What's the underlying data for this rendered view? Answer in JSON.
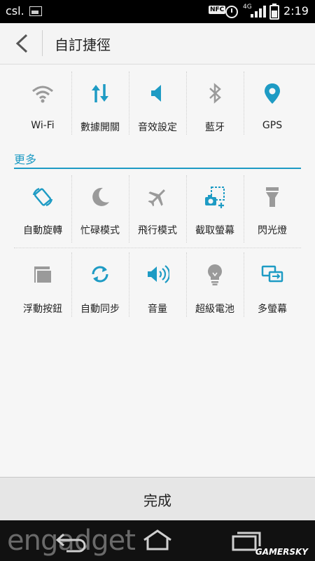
{
  "status_bar": {
    "carrier": "csl.",
    "network": "4G",
    "time": "2:19",
    "nfc": "NFC"
  },
  "header": {
    "back_icon": "chevron-left-icon",
    "title": "自訂捷徑"
  },
  "active_shortcuts": [
    {
      "label": "Wi-Fi",
      "icon": "wifi-icon"
    },
    {
      "label": "數據開關",
      "icon": "data-toggle-icon"
    },
    {
      "label": "音效設定",
      "icon": "sound-icon"
    },
    {
      "label": "藍牙",
      "icon": "bluetooth-icon"
    },
    {
      "label": "GPS",
      "icon": "location-pin-icon"
    }
  ],
  "more_section": {
    "label": "更多",
    "rows": [
      [
        {
          "label": "自動旋轉",
          "icon": "auto-rotate-icon"
        },
        {
          "label": "忙碌模式",
          "icon": "moon-icon"
        },
        {
          "label": "飛行模式",
          "icon": "airplane-icon"
        },
        {
          "label": "截取螢幕",
          "icon": "screenshot-icon"
        },
        {
          "label": "閃光燈",
          "icon": "flashlight-icon"
        }
      ],
      [
        {
          "label": "浮動按鈕",
          "icon": "floating-button-icon"
        },
        {
          "label": "自動同步",
          "icon": "sync-icon"
        },
        {
          "label": "音量",
          "icon": "volume-icon"
        },
        {
          "label": "超級電池",
          "icon": "lightbulb-icon"
        },
        {
          "label": "多螢幕",
          "icon": "multi-screen-icon"
        }
      ]
    ]
  },
  "done_button": {
    "label": "完成"
  },
  "watermark": {
    "text": "engadget",
    "site": "GAMERSKY"
  },
  "colors": {
    "accent": "#1e9bc4",
    "inactive": "#9a9a9a"
  }
}
